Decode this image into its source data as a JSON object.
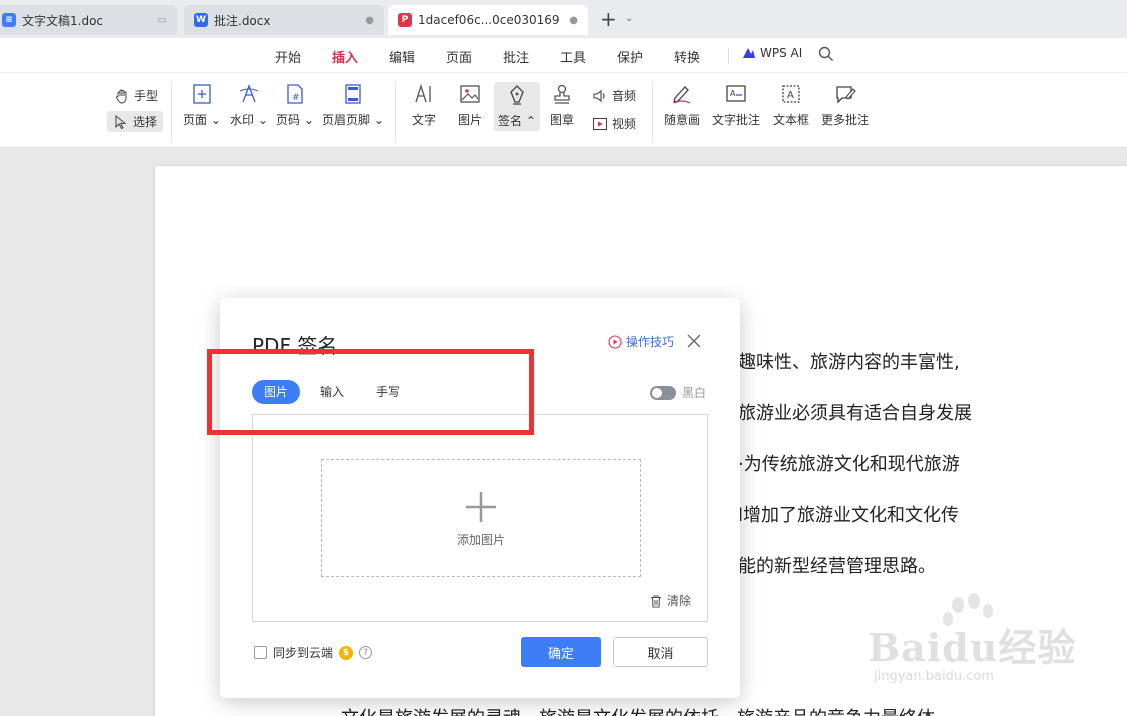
{
  "tabs": [
    {
      "label": "文字文稿1.doc",
      "icon": "document-icon",
      "color": "#3d7ef7"
    },
    {
      "label": "批注.docx",
      "icon": "word-icon",
      "color": "#2f6bf0"
    },
    {
      "label": "1dacef06c...0ce030169",
      "icon": "pdf-icon",
      "color": "#e0364d"
    }
  ],
  "menu": {
    "items": [
      "开始",
      "插入",
      "编辑",
      "页面",
      "批注",
      "工具",
      "保护",
      "转换"
    ],
    "active": "插入",
    "wps_ai": "WPS AI"
  },
  "ribbon": {
    "hand": "手型",
    "select": "选择",
    "page": "页面",
    "watermark": "水印",
    "page_number": "页码",
    "header_footer": "页眉页脚",
    "text": "文字",
    "image": "图片",
    "sign": "签名",
    "stamp": "图章",
    "audio": "音频",
    "video": "视频",
    "freehand": "随意画",
    "text_comment": "文字批注",
    "text_box": "文本框",
    "more_comments": "更多批注"
  },
  "document": {
    "lines": [
      "趣味性、旅游内容的丰富性,",
      "旅游业必须具有适合自身发展",
      "·为传统旅游文化和现代旅游",
      "l增加了旅游业文化和文化传",
      "能的新型经营管理思路。",
      "文化是旅游发展的灵魂，旅游是文化发展的依托，旅游产品的竞争力最终体"
    ]
  },
  "dialog": {
    "title": "PDF 签名",
    "tips": "操作技巧",
    "tabs": [
      "图片",
      "输入",
      "手写"
    ],
    "active_tab": "图片",
    "bw_label": "黑白",
    "bw_enabled": false,
    "add_image": "添加图片",
    "clear": "清除",
    "sync_label": "同步到云端",
    "sync_checked": false,
    "ok": "确定",
    "cancel": "取消"
  },
  "watermark": {
    "brand": "Baidu经验",
    "url": "jingyan.baidu.com"
  },
  "colors": {
    "accent_blue": "#3d7ef7",
    "menu_active": "#d72f4e",
    "highlight_red": "#ee3131"
  }
}
